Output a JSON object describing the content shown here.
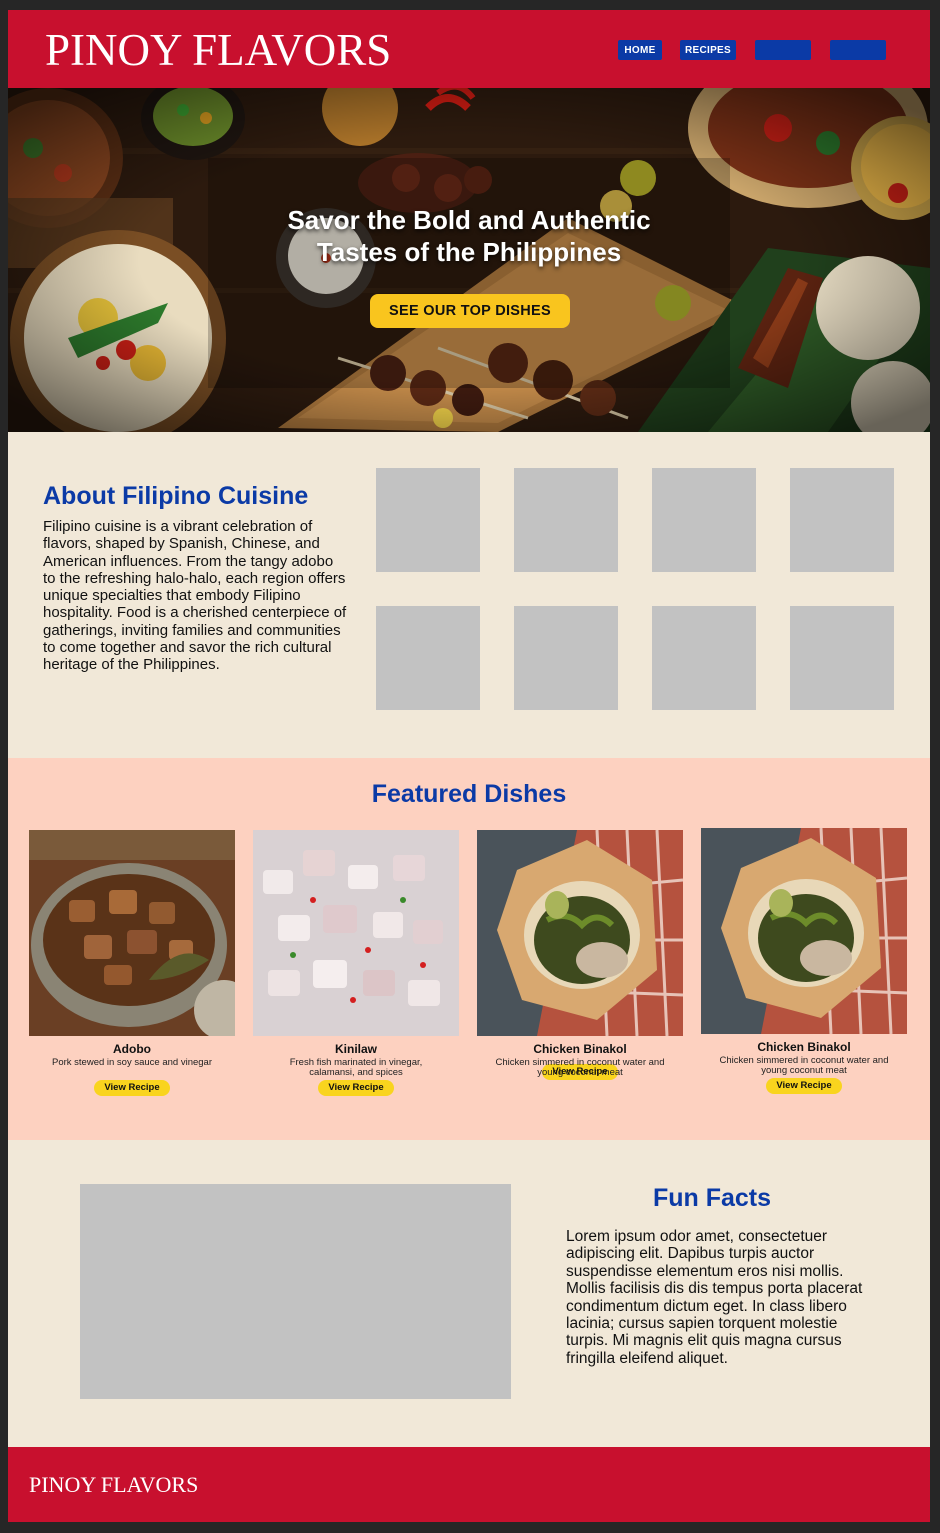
{
  "site": {
    "logo": "PINOY FLAVORS"
  },
  "nav": {
    "items": [
      {
        "label": "HOME"
      },
      {
        "label": "RECIPES"
      },
      {
        "label": ""
      },
      {
        "label": ""
      }
    ]
  },
  "hero": {
    "title_line1": "Savor the Bold and Authentic",
    "title_line2": "Tastes of the Philippines",
    "cta_label": "SEE OUR TOP DISHES"
  },
  "about": {
    "title": "About Filipino Cuisine",
    "text": "Filipino cuisine is a vibrant celebration of flavors, shaped by Spanish, Chinese, and American influences. From the tangy adobo to the refreshing halo-halo, each region offers unique specialties that embody Filipino hospitality. Food is a cherished centerpiece of gatherings, inviting families and communities to come together and savor the rich cultural heritage of the Philippines."
  },
  "featured": {
    "title": "Featured Dishes",
    "dishes": [
      {
        "name": "Adobo",
        "description": "Pork stewed in soy sauce and vinegar",
        "button": "View Recipe"
      },
      {
        "name": "Kinilaw",
        "description": "Fresh fish marinated in vinegar, calamansi, and spices",
        "button": "View Recipe"
      },
      {
        "name": "Chicken Binakol",
        "description": "Chicken simmered in coconut water and young coconut meat",
        "button": "View Recipe"
      },
      {
        "name": "Chicken Binakol",
        "description": "Chicken simmered in coconut water and young coconut meat",
        "button": "View Recipe"
      }
    ]
  },
  "fun_facts": {
    "title": "Fun Facts",
    "text": "Lorem ipsum odor amet, consectetuer adipiscing elit. Dapibus turpis auctor suspendisse elementum eros nisi mollis. Mollis facilisis dis dis tempus porta placerat condimentum dictum eget. In class libero lacinia; cursus sapien torquent molestie turpis. Mi magnis elit quis magna cursus fringilla eleifend aliquet."
  },
  "footer": {
    "logo": "PINOY FLAVORS"
  },
  "colors": {
    "brand_red": "#c8102e",
    "brand_blue": "#0b3aa6",
    "accent_yellow": "#f9c51e",
    "cream": "#f1e8d8",
    "peach": "#fdd1c0"
  }
}
